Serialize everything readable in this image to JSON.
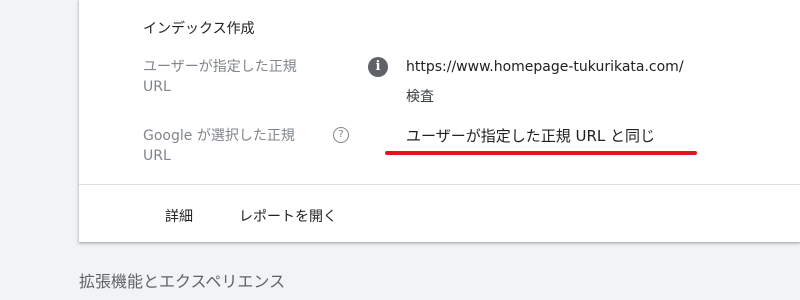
{
  "card": {
    "section_title": "インデックス作成",
    "user_canonical": {
      "label_line1": "ユーザーが指定した正規",
      "label_line2": "URL",
      "info_icon": "i",
      "value": "https://www.homepage-tukurikata.com/",
      "inspect_label": "検査"
    },
    "google_canonical": {
      "label_line1": "Google が選択した正規",
      "label_line2": "URL",
      "help_icon": "?",
      "value": "ユーザーが指定した正規 URL と同じ"
    },
    "actions": {
      "details_label": "詳細",
      "open_report_label": "レポートを開く"
    }
  },
  "enhancements_heading": "拡張機能とエクスペリエンス",
  "colors": {
    "annotation_underline": "#e0161f",
    "background": "#f1f3f4",
    "card": "#ffffff"
  }
}
